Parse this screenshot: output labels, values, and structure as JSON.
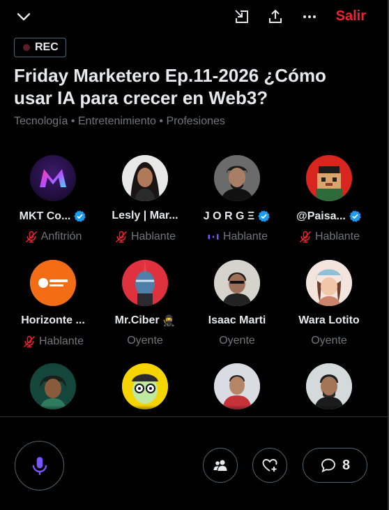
{
  "header": {
    "collapse_icon": "chevron-down-icon",
    "dock_icon": "minimize-to-dock-icon",
    "share_icon": "share-icon",
    "more_icon": "more-horizontal-icon",
    "exit_label": "Salir"
  },
  "rec_badge": "REC",
  "space": {
    "title": "Friday Marketero Ep.11-2026 ¿Cómo usar IA para crecer en Web3?",
    "tags": "Tecnología • Entretenimiento • Profesiones"
  },
  "participants": [
    {
      "name": "MKT Co...",
      "role": "Anfitrión",
      "verified": true,
      "role_icon": "mic-muted-icon"
    },
    {
      "name": "Lesly | Mar...",
      "role": "Hablante",
      "verified": false,
      "role_icon": "mic-muted-icon"
    },
    {
      "name": "J O R G Ξ",
      "role": "Hablante",
      "verified": true,
      "role_icon": "speaking-bars-icon"
    },
    {
      "name": "@Paisa...",
      "role": "Hablante",
      "verified": true,
      "role_icon": "mic-muted-icon"
    },
    {
      "name": "Horizonte ...",
      "role": "Hablante",
      "verified": false,
      "role_icon": "mic-muted-icon"
    },
    {
      "name": "Mr.Ciber",
      "role": "Oyente",
      "verified": false,
      "emoji": "🥷"
    },
    {
      "name": "Isaac Marti",
      "role": "Oyente",
      "verified": false
    },
    {
      "name": "Wara Lotito",
      "role": "Oyente",
      "verified": false
    },
    {
      "name": "",
      "role": "",
      "verified": false
    },
    {
      "name": "",
      "role": "",
      "verified": false
    },
    {
      "name": "",
      "role": "",
      "verified": false
    },
    {
      "name": "",
      "role": "",
      "verified": false
    }
  ],
  "footer": {
    "mic_icon": "microphone-icon",
    "people_icon": "people-icon",
    "react_icon": "heart-plus-icon",
    "comment_icon": "comment-icon",
    "comment_count": "8"
  },
  "colors": {
    "accent_red": "#f4212e",
    "verified_blue": "#1d9bf0",
    "mic_purple": "#7856ff",
    "muted_text": "#71767b"
  }
}
